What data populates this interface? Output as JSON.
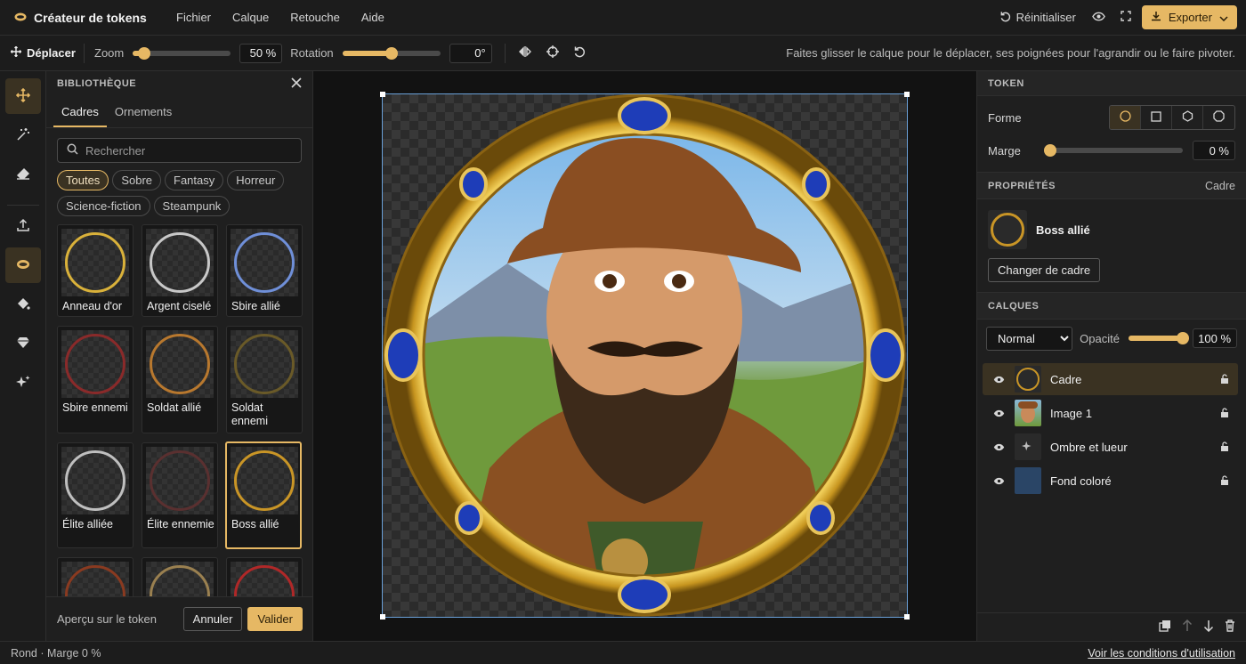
{
  "app": {
    "title": "Créateur de tokens"
  },
  "menu": [
    "Fichier",
    "Calque",
    "Retouche",
    "Aide"
  ],
  "topbar": {
    "reset_label": "Réinitialiser",
    "export_label": "Exporter"
  },
  "toolbar": {
    "move_label": "Déplacer",
    "zoom_label": "Zoom",
    "zoom_value": "50 %",
    "zoom_level": 0.12,
    "rotation_label": "Rotation",
    "rotation_value": "0°",
    "rotation_level": 0.5,
    "hint": "Faites glisser le calque pour le déplacer, ses poignées pour l'agrandir ou le faire pivoter."
  },
  "library": {
    "title": "BIBLIOTHÈQUE",
    "tabs": [
      "Cadres",
      "Ornements"
    ],
    "search_placeholder": "Rechercher",
    "filters": [
      "Toutes",
      "Sobre",
      "Fantasy",
      "Horreur",
      "Science-fiction",
      "Steampunk"
    ],
    "frames": [
      {
        "name": "Anneau d'or",
        "color": "#d9b13a"
      },
      {
        "name": "Argent ciselé",
        "color": "#c8c8c8"
      },
      {
        "name": "Sbire allié",
        "color": "#6f8fd8"
      },
      {
        "name": "Sbire ennemi",
        "color": "#8a2a2a"
      },
      {
        "name": "Soldat allié",
        "color": "#b8782e"
      },
      {
        "name": "Soldat ennemi",
        "color": "#6a5a28"
      },
      {
        "name": "Élite alliée",
        "color": "#bfbfbf"
      },
      {
        "name": "Élite ennemie",
        "color": "#5a3030"
      },
      {
        "name": "Boss allié",
        "color": "#c99526"
      },
      {
        "name": "",
        "color": "#8a3a20"
      },
      {
        "name": "",
        "color": "#9a8050"
      },
      {
        "name": "",
        "color": "#b02828"
      }
    ],
    "preview_label": "Aperçu sur le token",
    "cancel_label": "Annuler",
    "confirm_label": "Valider"
  },
  "token": {
    "title": "TOKEN",
    "shape_label": "Forme",
    "margin_label": "Marge",
    "margin_value": "0 %",
    "margin_level": 0
  },
  "properties": {
    "title": "PROPRIÉTÉS",
    "kind": "Cadre",
    "frame_name": "Boss allié",
    "change_label": "Changer de cadre"
  },
  "layers": {
    "title": "CALQUES",
    "blend_mode": "Normal",
    "opacity_label": "Opacité",
    "opacity_value": "100 %",
    "opacity_level": 1,
    "items": [
      {
        "name": "Cadre"
      },
      {
        "name": "Image 1"
      },
      {
        "name": "Ombre et lueur"
      },
      {
        "name": "Fond coloré"
      }
    ]
  },
  "status": {
    "text": "Rond · Marge 0 %",
    "terms": "Voir les conditions d'utilisation"
  },
  "colors": {
    "accent": "#e6b864",
    "fond_colore": "#2a4566"
  }
}
